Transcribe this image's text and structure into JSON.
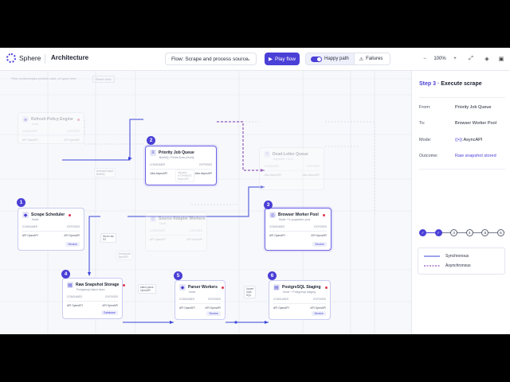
{
  "app": {
    "brand": "Sphere",
    "section": "Architecture"
  },
  "toolbar": {
    "flow_select": "Flow: Scrape and process source",
    "play_label": "Play flow",
    "happy_path_label": "Happy path",
    "failures_label": "Failures",
    "zoom_level": "100%"
  },
  "canvas": {
    "filter_placeholder": "Filter nodes/edges (double-click, or type) here",
    "reset_label": "Reset view"
  },
  "nodes": {
    "scheduler": {
      "step": "1",
      "title": "Scrape Scheduler",
      "sub": "Node",
      "col_in": "CONSUMES",
      "col_out": "EXPOSES",
      "row_in": "API  OpenAPI",
      "row_out": "API  OpenAPI",
      "tag": "Service"
    },
    "queue": {
      "step": "2",
      "title": "Priority Job Queue",
      "sub": "BullMQ / Redis Boss priority",
      "col_in": "CONSUMES",
      "col_out": "EXPOSES",
      "row_in": "Jobs  AsyncAPI",
      "row_out": "Jobs  AsyncAPI"
    },
    "worker": {
      "step": "3",
      "title": "Browser Worker Pool",
      "sub": "Node + K-puppeteer pool",
      "col_in": "CONSUMES",
      "col_out": "EXPOSES",
      "row_in": "API  OpenAPI",
      "row_out": "API  OpenAPI",
      "tag": "Service"
    },
    "storage": {
      "step": "4",
      "title": "Raw Snapshot Storage",
      "sub": "Postgresql object store",
      "col_in": "CONSUMES",
      "col_out": "EXPOSES",
      "row_in": "API  OpenAPI",
      "row_out": "API  OpenAPI",
      "tag": "Database"
    },
    "parser": {
      "step": "5",
      "title": "Parser Workers",
      "sub": "Node",
      "col_in": "CONSUMES",
      "col_out": "EXPOSES",
      "row_in": "API  OpenAPI",
      "row_out": "API  OpenAPI",
      "tag": "Service"
    },
    "staging": {
      "step": "6",
      "title": "PostgreSQL Staging",
      "sub": "Node + Postgresql staging",
      "col_in": "CONSUMES",
      "col_out": "EXPOSES",
      "row_in": "API  OpenAPI",
      "row_out": "API  OpenAPI",
      "tag": "Service"
    },
    "policy": {
      "title": "Refresh Policy Engine",
      "sub": "Node",
      "col_in": "CONSUMES",
      "col_out": "EXPOSES",
      "row_in": "API  OpenAPI",
      "row_out": "API  OpenAPI"
    },
    "deadletter": {
      "title": "Dead-Letter Queue",
      "sub": "AsyncAPI / DLQ",
      "col_in": "CONSUMES",
      "col_out": "EXPOSES",
      "row_in": "Jobs  AsyncAPI",
      "row_out": "Jobs  AsyncAPI"
    },
    "adapter": {
      "title": "Source Adapter Workers",
      "sub": "Node",
      "col_in": "CONSUMES",
      "col_out": "EXPOSES",
      "row_in": "API  OpenAPI",
      "row_out": "API  OpenAPI"
    }
  },
  "edge_labels": {
    "e1": "schedule batch\nBullMQ",
    "e2": "dispatch\nHTTP/REST\nAsyncAPI",
    "e3": "Store raw\nS3",
    "e4": "Checkpoint\nOpenAPI",
    "e5": "batch parse\nOpenAPI",
    "e6": "Upsert\nrows\nSQL"
  },
  "panel": {
    "step_prefix": "Step 3 ·",
    "title": "Execute scrape",
    "from_label": "From:",
    "from_value": "Priority Job Queue",
    "to_label": "To:",
    "to_value": "Browser Worker Pool",
    "mode_label": "Mode:",
    "mode_value": "AsyncAPI",
    "outcome_label": "Outcome:",
    "outcome_value": "Raw snapshot stored",
    "steps": [
      "1",
      "2",
      "3",
      "4",
      "5",
      "6"
    ],
    "completed_steps": 2,
    "legend_sync": "Synchronous",
    "legend_async": "Asynchronous"
  },
  "colors": {
    "accent": "#4a3fd6",
    "status_dot": "#e0344b",
    "sync_line": "#3a45d9",
    "async_line": "#7a2fa8"
  }
}
